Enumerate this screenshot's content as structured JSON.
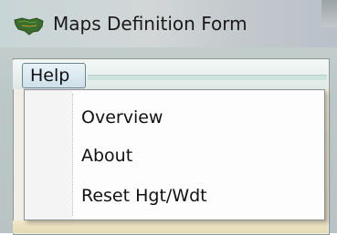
{
  "window": {
    "title": "Maps Definition Form",
    "icon": "us-map-icon"
  },
  "menubar": {
    "help_label": "Help"
  },
  "help_dropdown": {
    "items": [
      {
        "label": "Overview"
      },
      {
        "label": "About"
      },
      {
        "label": "Reset Hgt/Wdt"
      }
    ]
  },
  "colors": {
    "menu_highlight_border": "#6f8690",
    "dropdown_background": "#fdfdfd",
    "map_background": "#efe6c8"
  }
}
